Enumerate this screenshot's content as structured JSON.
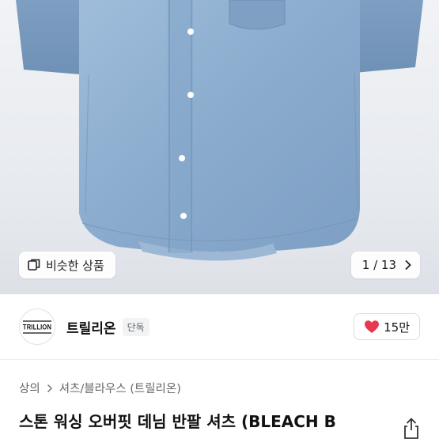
{
  "gallery": {
    "similar_label": "비슷한 상품",
    "pager_text": "1 / 13"
  },
  "seller": {
    "avatar_text": "TRILLION",
    "name": "트릴리온",
    "badge": "단독",
    "like_count": "15만"
  },
  "breadcrumb": {
    "items": [
      "상의",
      "셔츠/블라우스 (트릴리온)"
    ]
  },
  "product": {
    "title": "스톤 워싱 오버핏 데님 반팔 셔츠 (BLEACH B"
  },
  "colors": {
    "heart": "#e8384f",
    "denim": "#8fb0d1"
  }
}
